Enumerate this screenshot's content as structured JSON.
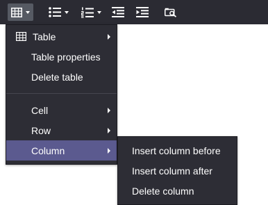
{
  "toolbar": {
    "buttons": [
      {
        "icon": "table-icon",
        "has_dropdown": true,
        "active": true
      },
      {
        "icon": "bullet-list-icon",
        "has_dropdown": true
      },
      {
        "icon": "numbered-list-icon",
        "has_dropdown": true
      },
      {
        "icon": "outdent-icon",
        "has_dropdown": false
      },
      {
        "icon": "indent-icon",
        "has_dropdown": false
      },
      {
        "icon": "find-replace-icon",
        "has_dropdown": false
      }
    ]
  },
  "menu": {
    "items": [
      {
        "label": "Table",
        "icon": "table-icon",
        "submenu": true
      },
      {
        "label": "Table properties"
      },
      {
        "label": "Delete table"
      },
      {
        "label": "Cell",
        "submenu": true
      },
      {
        "label": "Row",
        "submenu": true
      },
      {
        "label": "Column",
        "submenu": true,
        "highlighted": true
      }
    ]
  },
  "submenu": {
    "items": [
      {
        "label": "Insert column before"
      },
      {
        "label": "Insert column after"
      },
      {
        "label": "Delete column"
      }
    ]
  },
  "colors": {
    "toolbar_bg": "#2b2b33",
    "menu_bg": "#2d2d35",
    "highlight": "#5b5a8f",
    "active_button": "#565a63",
    "text": "#ffffff"
  }
}
